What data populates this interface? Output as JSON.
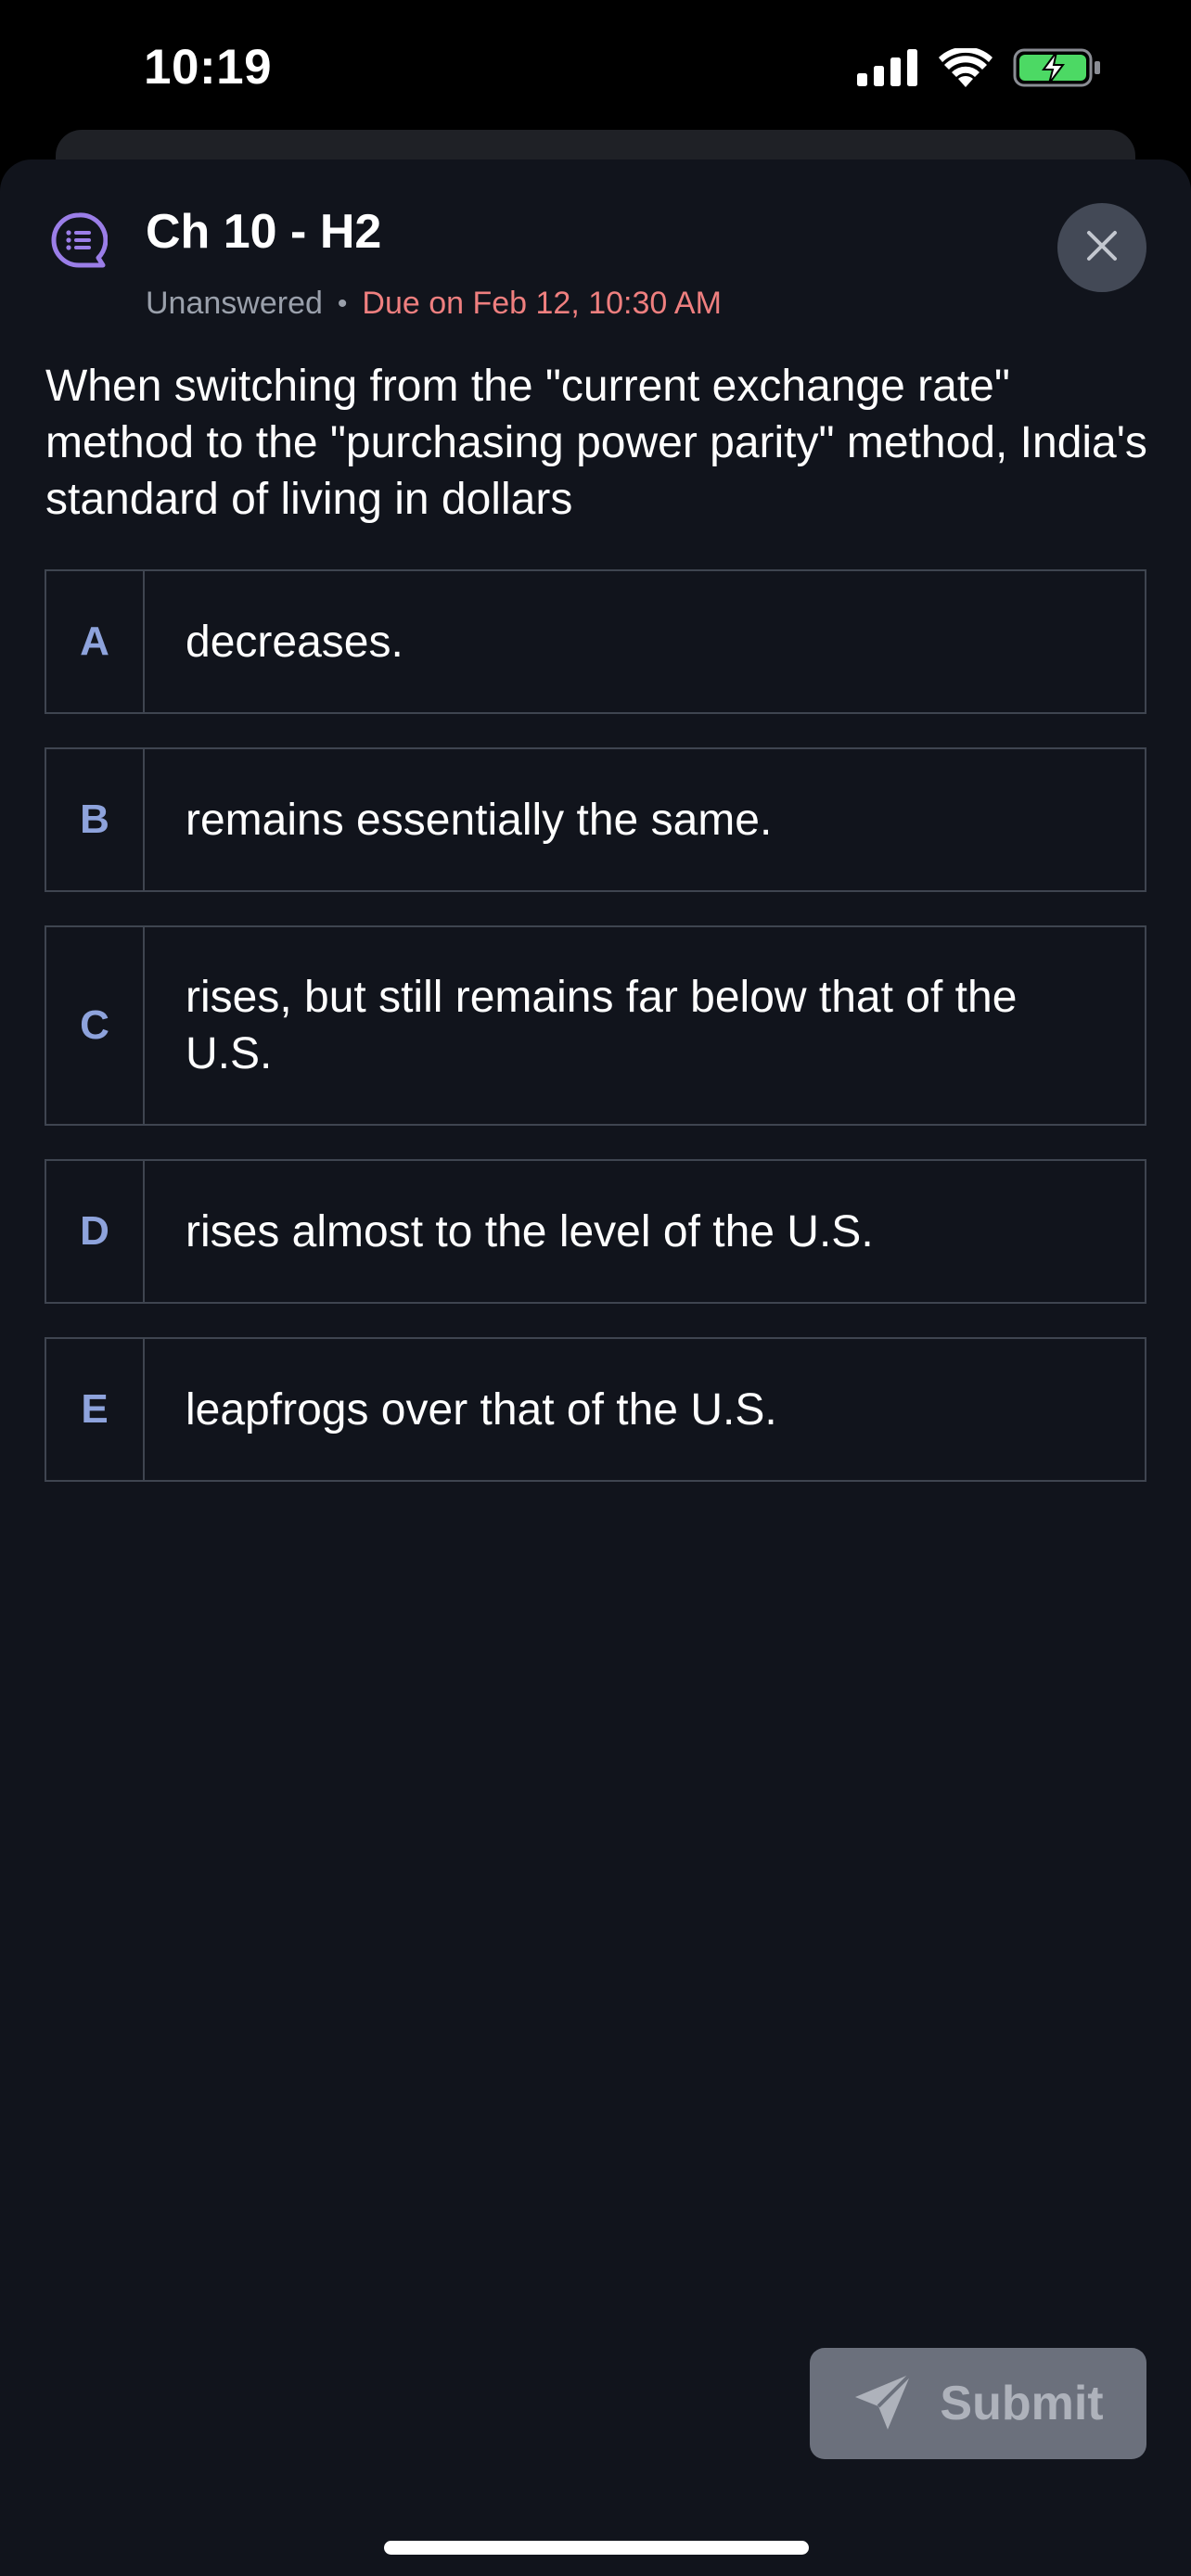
{
  "status_bar": {
    "time": "10:19",
    "signal_icon": "cellular-signal-icon",
    "wifi_icon": "wifi-icon",
    "battery_icon": "battery-charging-icon",
    "battery_color": "#4cd964"
  },
  "header": {
    "icon": "discussion-list-icon",
    "icon_color": "#9b7ee8",
    "title": "Ch 10 - H2",
    "status": "Unanswered",
    "separator": "•",
    "due": "Due on Feb 12, 10:30 AM",
    "due_color": "#ef7f7f",
    "close_icon": "close-icon"
  },
  "question": {
    "text": "When switching from the \"current exchange rate\" method to the \"purchasing power parity\" method, India's standard of living in dollars"
  },
  "options": [
    {
      "letter": "A",
      "text": "decreases."
    },
    {
      "letter": "B",
      "text": "remains essentially the same."
    },
    {
      "letter": "C",
      "text": "rises, but still remains far below that of the U.S."
    },
    {
      "letter": "D",
      "text": "rises almost to the level of the U.S."
    },
    {
      "letter": "E",
      "text": "leapfrogs over that of the U.S."
    }
  ],
  "submit": {
    "label": "Submit",
    "icon": "send-icon"
  },
  "colors": {
    "sheet_background": "#11141c",
    "option_letter": "#8ea3dc",
    "option_border": "#3f4550"
  }
}
